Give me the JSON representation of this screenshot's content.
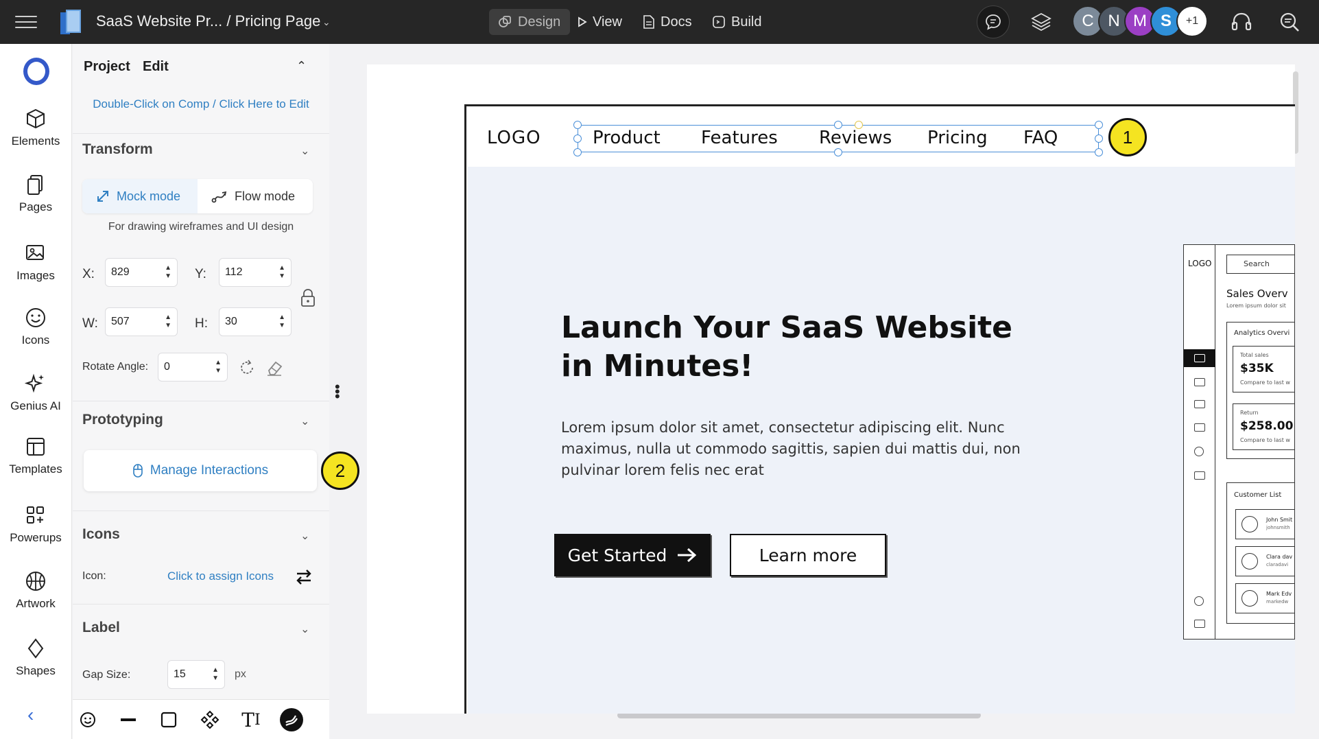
{
  "topbar": {
    "project_title": "SaaS Website Pr... / Pricing Page",
    "nav": {
      "design": "Design",
      "view": "View",
      "docs": "Docs",
      "build": "Build"
    },
    "avatars": [
      "C",
      "N",
      "M",
      "S"
    ],
    "avatar_more": "+1"
  },
  "rail": {
    "items": [
      "Elements",
      "Pages",
      "Images",
      "Icons",
      "Genius AI",
      "Templates",
      "Powerups",
      "Artwork",
      "Shapes"
    ]
  },
  "panel": {
    "tabs": {
      "project": "Project",
      "edit": "Edit"
    },
    "edit_hint": "Double-Click on Comp / Click Here to Edit",
    "transform": {
      "title": "Transform",
      "modes": {
        "mock": "Mock mode",
        "flow": "Flow mode"
      },
      "mode_description": "For drawing wireframes and UI design",
      "x_label": "X:",
      "x": "829",
      "y_label": "Y:",
      "y": "112",
      "w_label": "W:",
      "w": "507",
      "h_label": "H:",
      "h": "30",
      "rotate_label": "Rotate Angle:",
      "rotate": "0"
    },
    "prototyping": {
      "title": "Prototyping",
      "manage": "Manage Interactions"
    },
    "icons": {
      "title": "Icons",
      "icon_label": "Icon:",
      "assign": "Click to assign Icons"
    },
    "label": {
      "title": "Label",
      "gap_label": "Gap Size:",
      "gap": "15",
      "unit": "px"
    }
  },
  "badges": {
    "one": "1",
    "two": "2"
  },
  "canvas": {
    "logo": "LOGO",
    "nav_links": [
      "Product",
      "Features",
      "Reviews",
      "Pricing",
      "FAQ"
    ],
    "hero_title": "Launch Your SaaS Website in Minutes!",
    "hero_body": "Lorem ipsum dolor sit amet, consectetur adipiscing elit. Nunc maximus, nulla ut commodo sagittis, sapien dui mattis dui, non pulvinar lorem felis nec erat",
    "cta_primary": "Get Started",
    "cta_secondary": "Learn more",
    "dashboard": {
      "logo": "LOGO",
      "search": "Search",
      "heading": "Sales Overv",
      "subheading": "Lorem ipsum dolor sit",
      "analytics_title": "Analytics Overvi",
      "total_label": "Total sales",
      "total_value": "$35K",
      "total_compare": "Compare to last w",
      "return_label": "Return",
      "return_value": "$258.00",
      "return_compare": "Compare to last w",
      "customer_title": "Customer List",
      "customers": [
        {
          "name": "John Smit",
          "email": "johnsmith"
        },
        {
          "name": "Clara dav",
          "email": "claradavi"
        },
        {
          "name": "Mark Edv",
          "email": "markedw"
        }
      ]
    }
  },
  "colors": {
    "accent": "#2f7fc2",
    "badge": "#f5e421",
    "topbar": "#262626",
    "selection": "#4a8fd8"
  }
}
